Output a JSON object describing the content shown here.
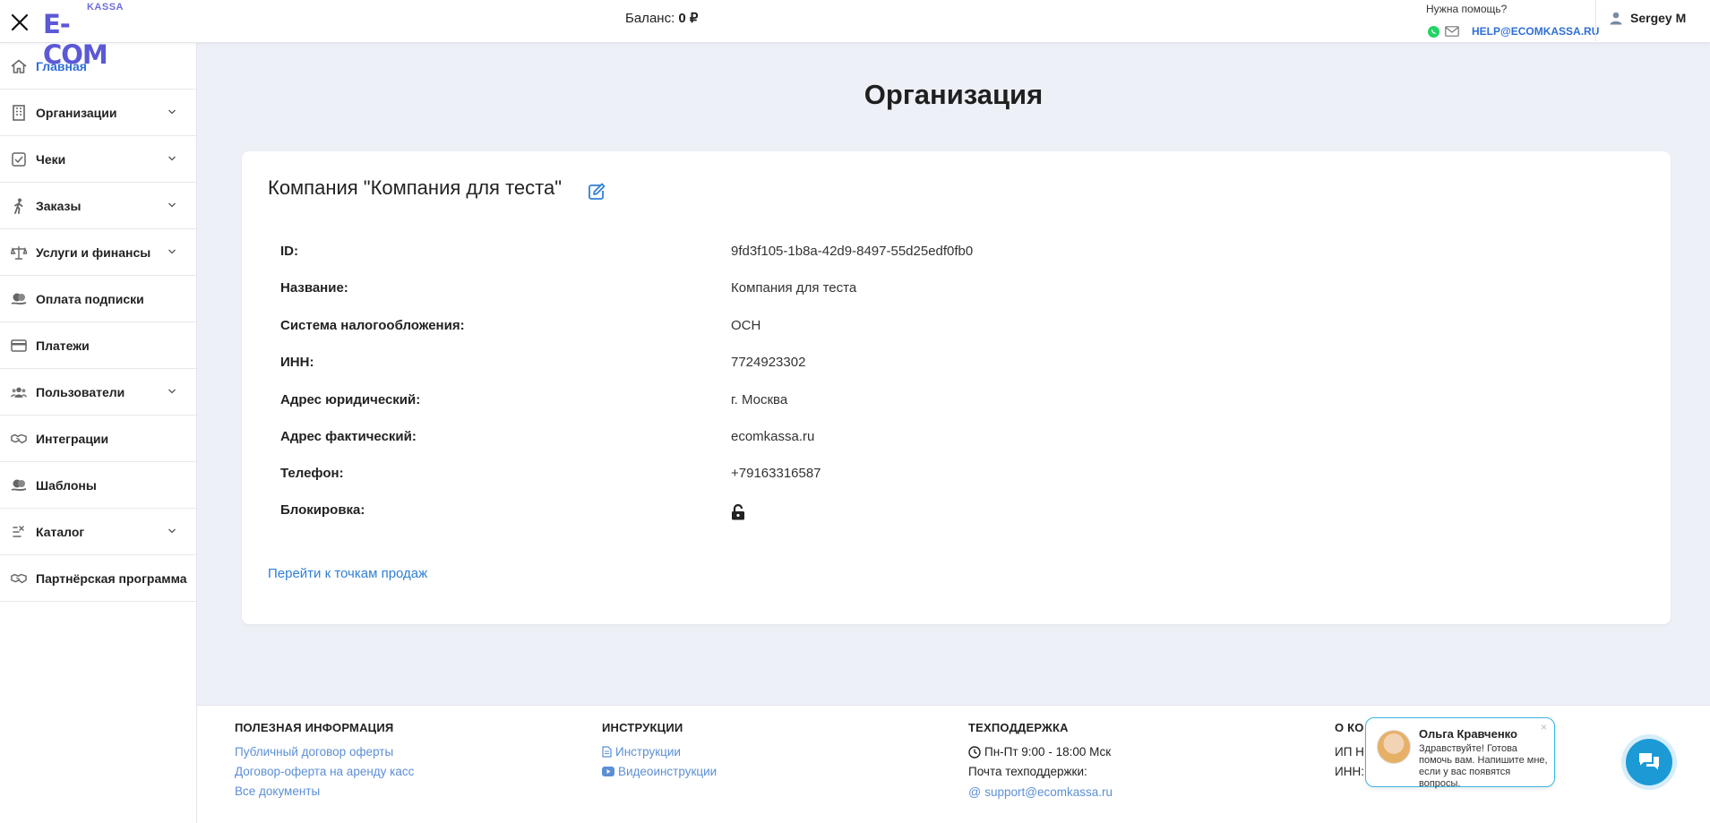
{
  "header": {
    "logo_top": "KASSA",
    "logo_main": "E-COM",
    "balance_label": "Баланс:",
    "balance_value": "0 ₽",
    "help_title": "Нужна помощь?",
    "help_email": "HELP@ECOMKASSA.RU",
    "user_name": "Sergey M"
  },
  "sidebar": {
    "items": [
      {
        "label": "Главная",
        "icon": "home-icon",
        "active": true,
        "has_chevron": false
      },
      {
        "label": "Организации",
        "icon": "building-icon",
        "active": false,
        "has_chevron": true
      },
      {
        "label": "Чеки",
        "icon": "checkbox-icon",
        "active": false,
        "has_chevron": true
      },
      {
        "label": "Заказы",
        "icon": "walking-person-icon",
        "active": false,
        "has_chevron": true
      },
      {
        "label": "Услуги и финансы",
        "icon": "scales-icon",
        "active": false,
        "has_chevron": true
      },
      {
        "label": "Оплата подписки",
        "icon": "coins-hand-icon",
        "active": false,
        "has_chevron": false
      },
      {
        "label": "Платежи",
        "icon": "credit-card-icon",
        "active": false,
        "has_chevron": false
      },
      {
        "label": "Пользователи",
        "icon": "users-icon",
        "active": false,
        "has_chevron": true
      },
      {
        "label": "Интеграции",
        "icon": "handshake-icon",
        "active": false,
        "has_chevron": false
      },
      {
        "label": "Шаблоны",
        "icon": "coins-hand-icon",
        "active": false,
        "has_chevron": false
      },
      {
        "label": "Каталог",
        "icon": "catalog-icon",
        "active": false,
        "has_chevron": true
      },
      {
        "label": "Партнёрская программа",
        "icon": "handshake-icon",
        "active": false,
        "has_chevron": false
      }
    ]
  },
  "main": {
    "page_title": "Организация",
    "card_title": "Компания \"Компания для теста\"",
    "fields": [
      {
        "key": "ID:",
        "value": "9fd3f105-1b8a-42d9-8497-55d25edf0fb0"
      },
      {
        "key": "Название:",
        "value": "Компания для теста"
      },
      {
        "key": "Система налогообложения:",
        "value": "ОСН"
      },
      {
        "key": "ИНН:",
        "value": "7724923302"
      },
      {
        "key": "Адрес юридический:",
        "value": "г. Москва"
      },
      {
        "key": "Адрес фактический:",
        "value": "ecomkassa.ru"
      },
      {
        "key": "Телефон:",
        "value": "+79163316587"
      },
      {
        "key": "Блокировка:",
        "value": ""
      }
    ],
    "lock_icon": "unlock-icon",
    "sales_points_link": "Перейти к точкам продаж"
  },
  "footer": {
    "useful": {
      "title": "ПОЛЕЗНАЯ ИНФОРМАЦИЯ",
      "links": [
        "Публичный договор оферты",
        "Договор-оферта на аренду касс",
        "Все документы"
      ]
    },
    "instructions": {
      "title": "ИНСТРУКЦИИ",
      "links": [
        "Инструкции",
        "Видеоинструкции"
      ]
    },
    "support": {
      "title": "ТЕХПОДДЕРЖКА",
      "hours": "Пн-Пт 9:00 - 18:00 Мск",
      "email_label": "Почта техподдержки:",
      "email": "support@ecomkassa.ru"
    },
    "company": {
      "title": "О КО",
      "line1": "ИП Н",
      "line2": "ИНН:"
    }
  },
  "chat": {
    "agent_name": "Ольга Кравченко",
    "message": "Здравствуйте! Готова помочь вам. Напишите мне, если у вас появятся вопросы.",
    "close": "×"
  },
  "colors": {
    "accent": "#2f6fd6",
    "logo": "#5b59d6",
    "chat": "#1c9ad6",
    "background": "#edf0f6"
  }
}
